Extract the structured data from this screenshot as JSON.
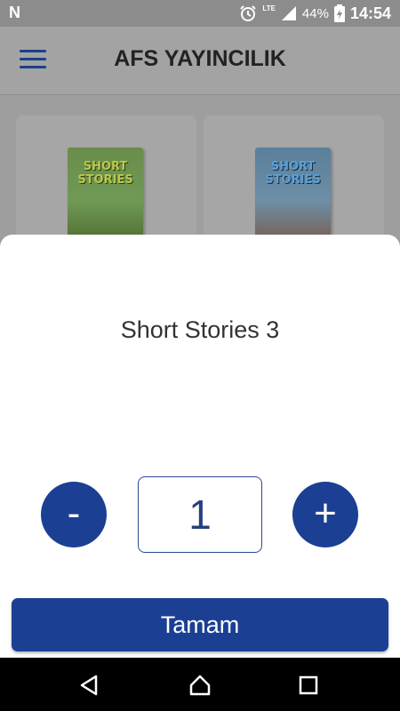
{
  "status_bar": {
    "carrier_icon": "N",
    "network_label": "LTE",
    "battery_percent": "44%",
    "time": "14:54"
  },
  "app_bar": {
    "title": "AFS YAYINCILIK"
  },
  "books": [
    {
      "cover_text": "SHORT STORIES"
    },
    {
      "cover_text": "SHORT STORIES"
    }
  ],
  "dialog": {
    "product_name": "Short Stories 3",
    "minus_label": "-",
    "quantity": "1",
    "plus_label": "+",
    "confirm_label": "Tamam"
  },
  "colors": {
    "primary": "#1b3f93",
    "sheet_background": "#ffffff"
  }
}
